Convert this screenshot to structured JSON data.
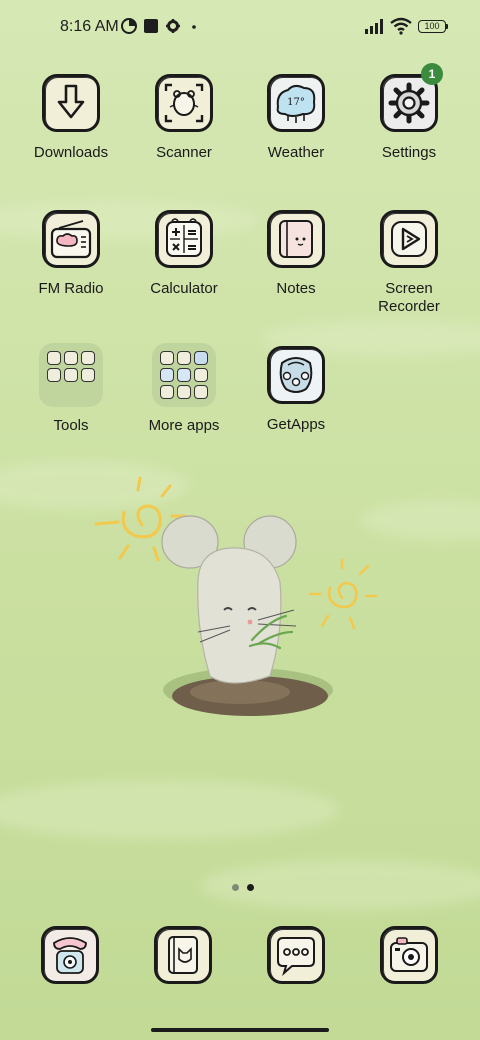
{
  "status_bar": {
    "time": "8:16 AM",
    "battery": "100",
    "icons": [
      "data-saver-icon",
      "app-square-icon",
      "gear-icon",
      "dot-icon"
    ],
    "right_icons": [
      "signal-icon",
      "wifi-icon",
      "battery-icon"
    ]
  },
  "apps": [
    {
      "name": "Downloads",
      "icon": "download-icon"
    },
    {
      "name": "Scanner",
      "icon": "scanner-icon"
    },
    {
      "name": "Weather",
      "icon": "weather-icon",
      "temp": "17°"
    },
    {
      "name": "Settings",
      "icon": "gear-icon",
      "badge": "1"
    },
    {
      "name": "FM Radio",
      "icon": "radio-icon"
    },
    {
      "name": "Calculator",
      "icon": "calculator-icon"
    },
    {
      "name": "Notes",
      "icon": "notes-icon"
    },
    {
      "name": "Screen\nRecorder",
      "icon": "screen-recorder-icon"
    },
    {
      "name": "Tools",
      "icon": "folder-icon"
    },
    {
      "name": "More apps",
      "icon": "folder-icon"
    },
    {
      "name": "GetApps",
      "icon": "getapps-icon"
    }
  ],
  "page_indicator": {
    "count": 2,
    "active": 2
  },
  "dock": [
    {
      "icon": "phone-icon"
    },
    {
      "icon": "contacts-icon"
    },
    {
      "icon": "messages-icon"
    },
    {
      "icon": "camera-icon"
    }
  ],
  "colors": {
    "background": "#cfe3a8",
    "badge": "#3b8b3f",
    "sun": "#f2c94c"
  }
}
